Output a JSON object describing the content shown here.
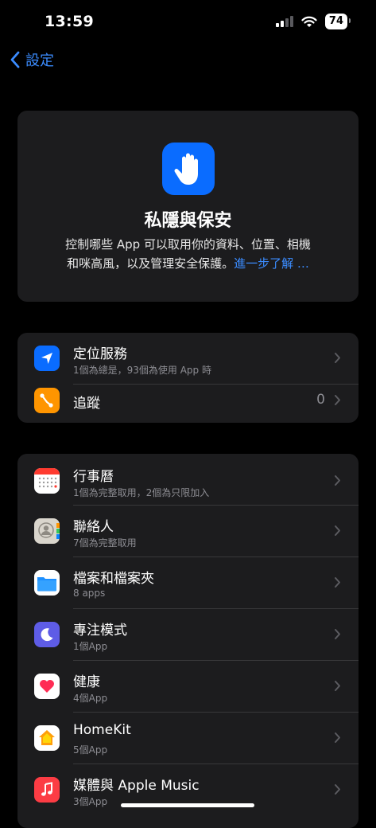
{
  "status": {
    "time": "13:59",
    "battery": "74"
  },
  "nav": {
    "back_label": "設定"
  },
  "hero": {
    "title": "私隱與保安",
    "desc_line1": "控制哪些 App 可以取用你的資料、位置、相機",
    "desc_line2": "和咪高風，以及管理安全保護。",
    "link": "進一步了解 …"
  },
  "group1": [
    {
      "title": "定位服務",
      "subtitle": "1個為總是，93個為使用 App 時",
      "icon": "location-arrow-icon",
      "color": "#0a6cff"
    },
    {
      "title": "追蹤",
      "value": "0",
      "icon": "tracking-icon",
      "color": "#ff9500"
    }
  ],
  "group2": [
    {
      "title": "行事曆",
      "subtitle": "1個為完整取用，2個為只限加入",
      "icon": "calendar-icon"
    },
    {
      "title": "聯絡人",
      "subtitle": "7個為完整取用",
      "icon": "contacts-icon"
    },
    {
      "title": "檔案和檔案夾",
      "subtitle": "8 apps",
      "icon": "folder-icon"
    },
    {
      "title": "專注模式",
      "subtitle": "1個App",
      "icon": "moon-icon",
      "color": "#5e5ce6"
    },
    {
      "title": "健康",
      "subtitle": "4個App",
      "icon": "heart-icon"
    },
    {
      "title": "HomeKit",
      "subtitle": "5個App",
      "icon": "home-icon"
    },
    {
      "title": "媒體與 Apple Music",
      "subtitle": "3個App",
      "icon": "music-note-icon",
      "color": "#fc3c44"
    }
  ]
}
